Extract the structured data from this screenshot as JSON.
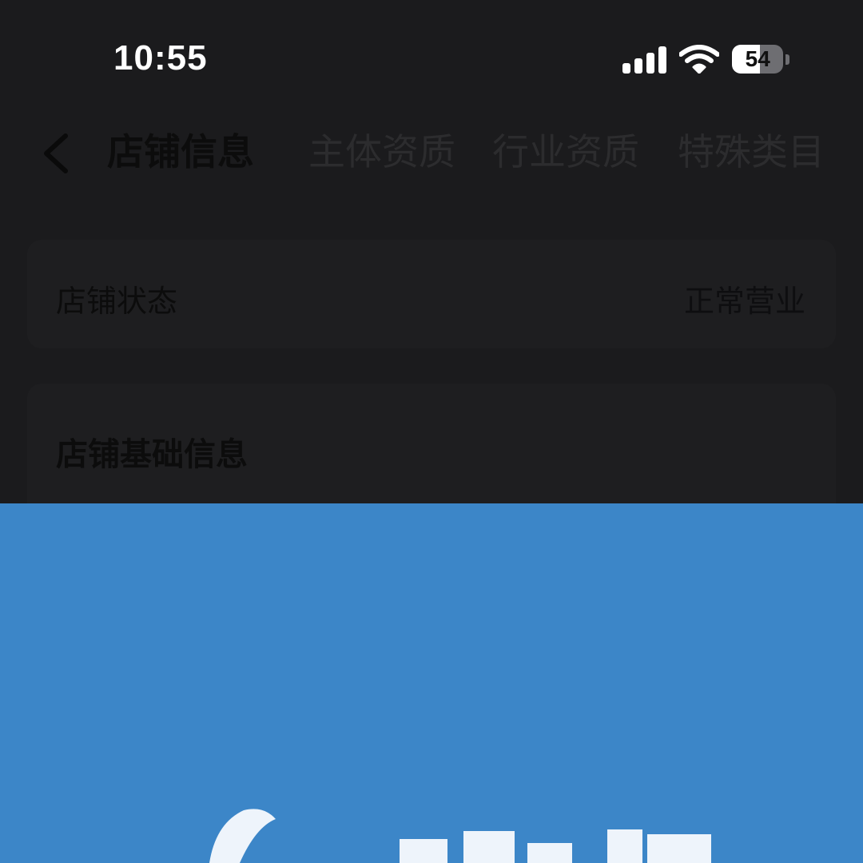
{
  "status_bar": {
    "time": "10:55",
    "battery_level": "54",
    "battery_fraction": 0.54,
    "signal_bars": 4,
    "icons": [
      "signal-icon",
      "wifi-icon",
      "battery-icon"
    ]
  },
  "nav": {
    "back_icon": "chevron-left-icon",
    "tabs": [
      {
        "label": "店铺信息",
        "active": true
      },
      {
        "label": "主体资质",
        "active": false
      },
      {
        "label": "行业资质",
        "active": false
      },
      {
        "label": "特殊类目",
        "active": false
      }
    ]
  },
  "store_status": {
    "label": "店铺状态",
    "value": "正常营业"
  },
  "store_basic": {
    "title": "店铺基础信息"
  },
  "overlay": {
    "color": "#3c86c8"
  }
}
